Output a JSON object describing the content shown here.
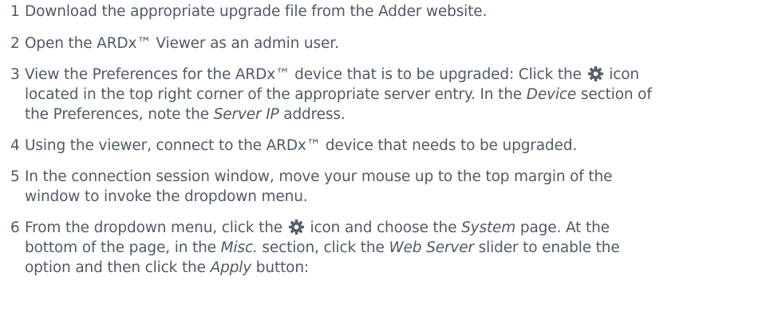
{
  "steps": [
    {
      "num": "1",
      "parts": [
        {
          "t": "Download the appropriate upgrade file from the Adder website."
        }
      ]
    },
    {
      "num": "2",
      "parts": [
        {
          "t": "Open the ARDx™ Viewer as an admin user."
        }
      ]
    },
    {
      "num": "3",
      "parts": [
        {
          "t": "View the Preferences for the ARDx™ device that is to be upgraded: Click the "
        },
        {
          "icon": "gear-icon"
        },
        {
          "t": " icon\nlocated in the top right corner of the appropriate server entry. In the "
        },
        {
          "t": "Device",
          "em": true
        },
        {
          "t": " section of\nthe Preferences, note the "
        },
        {
          "t": "Server IP",
          "em": true
        },
        {
          "t": " address."
        }
      ]
    },
    {
      "num": "4",
      "parts": [
        {
          "t": "Using the viewer, connect to the ARDx™ device that needs to be upgraded."
        }
      ]
    },
    {
      "num": "5",
      "parts": [
        {
          "t": "In the connection session window, move your mouse up to the top margin of the\nwindow to invoke the dropdown menu."
        }
      ]
    },
    {
      "num": "6",
      "parts": [
        {
          "t": "From the dropdown menu, click the "
        },
        {
          "icon": "gear-icon"
        },
        {
          "t": " icon and choose the "
        },
        {
          "t": "System",
          "em": true
        },
        {
          "t": " page. At the\nbottom of the page, in the "
        },
        {
          "t": "Misc.",
          "em": true
        },
        {
          "t": " section, click the "
        },
        {
          "t": "Web Server",
          "em": true
        },
        {
          "t": " slider to enable the\noption and then click the "
        },
        {
          "t": "Apply",
          "em": true
        },
        {
          "t": " button:"
        }
      ]
    }
  ]
}
